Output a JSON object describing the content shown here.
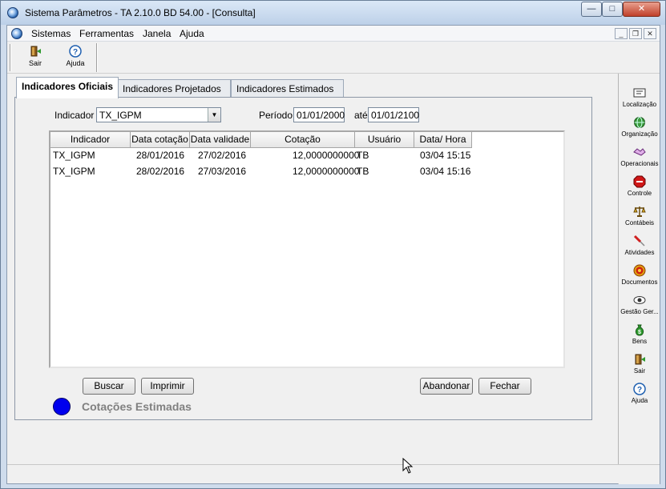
{
  "window": {
    "title": "Sistema Parâmetros -  TA 2.10.0 BD 54.00 - [Consulta]",
    "minimize": "—",
    "maximize": "□",
    "close": "✕"
  },
  "menu": {
    "items": [
      "Sistemas",
      "Ferramentas",
      "Janela",
      "Ajuda"
    ],
    "mdi_min": "_",
    "mdi_restore": "❐",
    "mdi_close": "✕"
  },
  "toolbar": {
    "sair": "Sair",
    "ajuda": "Ajuda"
  },
  "tabs": [
    {
      "label": "Indicadores Oficiais",
      "active": true
    },
    {
      "label": "Indicadores Projetados",
      "active": false
    },
    {
      "label": "Indicadores Estimados",
      "active": false
    }
  ],
  "filters": {
    "indicador_label": "Indicador",
    "indicador_value": "TX_IGPM",
    "periodo_label": "Período",
    "periodo_de": "01/01/2000",
    "ate_label": "até",
    "periodo_ate": "01/01/2100"
  },
  "grid": {
    "columns": [
      "Indicador",
      "Data cotação",
      "Data validade",
      "Cotação",
      "Usuário",
      "Data/ Hora"
    ],
    "rows": [
      [
        "TX_IGPM",
        "28/01/2016",
        "27/02/2016",
        "12,0000000000",
        "TB",
        "03/04 15:15"
      ],
      [
        "TX_IGPM",
        "28/02/2016",
        "27/03/2016",
        "12,0000000000",
        "TB",
        "03/04 15:16"
      ]
    ]
  },
  "buttons": {
    "buscar": "Buscar",
    "imprimir": "Imprimir",
    "abandonar": "Abandonar",
    "fechar": "Fechar"
  },
  "legend": {
    "text": "Cotações Estimadas",
    "color": "#0000ee"
  },
  "sidebar": {
    "items": [
      "Localização",
      "Organização",
      "Operacionais",
      "Controle",
      "Contábeis",
      "Atividades",
      "Documentos",
      "Gestão Ger...",
      "Bens",
      "Sair",
      "Ajuda"
    ]
  }
}
